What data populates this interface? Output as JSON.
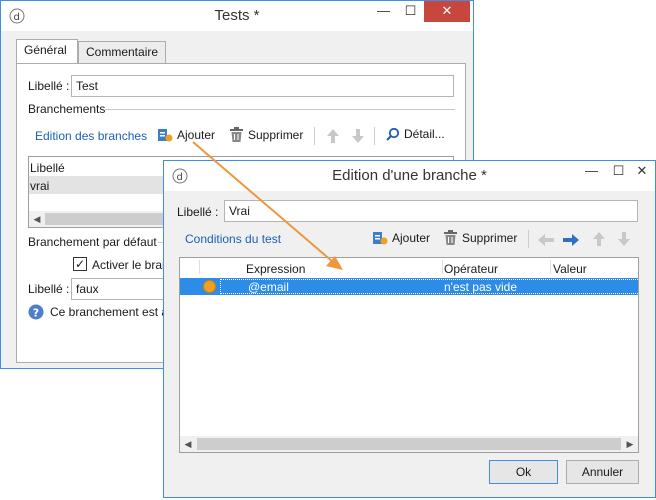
{
  "back_window": {
    "title": "Tests *",
    "tabs": [
      {
        "label": "Général"
      },
      {
        "label": "Commentaire"
      }
    ],
    "libelle_label": "Libellé :",
    "libelle_value": "Test",
    "branchements_label": "Branchements",
    "toolbar": {
      "edit_link": "Edition des branches",
      "add": "Ajouter",
      "delete": "Supprimer",
      "detail": "Détail..."
    },
    "list": {
      "header": "Libellé",
      "rows": [
        "vrai"
      ]
    },
    "default_label": "Branchement par défaut",
    "activate_label": "Activer le bran",
    "default_libelle_label": "Libellé :",
    "default_libelle_value": "faux",
    "info_text": "Ce branchement est a"
  },
  "front_window": {
    "title": "Edition d'une branche *",
    "libelle_label": "Libellé :",
    "libelle_value": "Vrai",
    "toolbar": {
      "conditions_link": "Conditions du test",
      "add": "Ajouter",
      "delete": "Supprimer"
    },
    "grid": {
      "columns": [
        "Expression",
        "Opérateur",
        "Valeur"
      ],
      "rows": [
        {
          "expression": "@email",
          "operator": "n'est pas vide",
          "value": ""
        }
      ]
    },
    "ok_label": "Ok",
    "cancel_label": "Annuler"
  },
  "colors": {
    "accent": "#3c8ee8",
    "selection": "#2c8ce6",
    "arrow": "#f0963c",
    "close": "#c7463d",
    "link": "#1c5fb8"
  }
}
